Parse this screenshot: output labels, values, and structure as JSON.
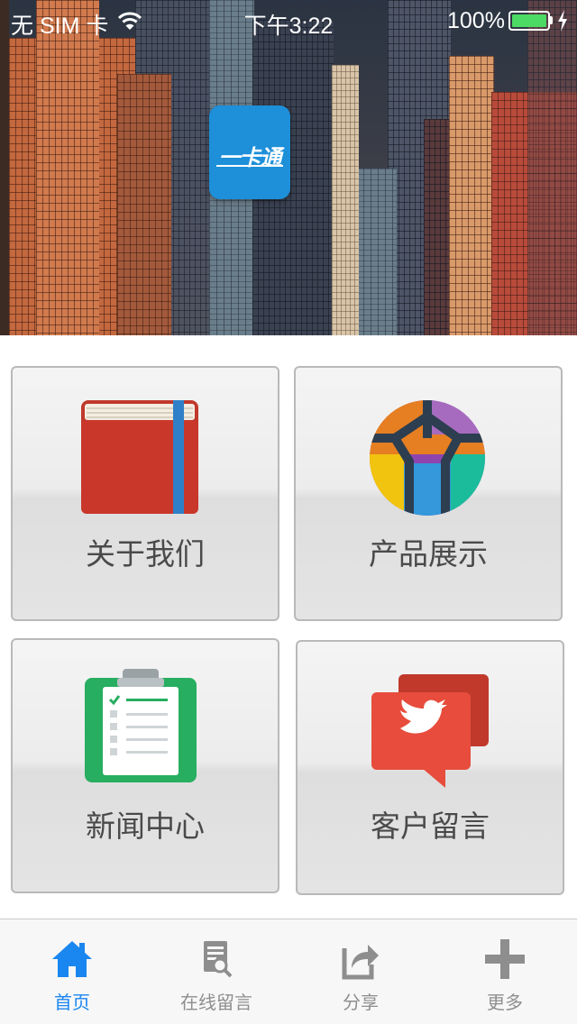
{
  "status_bar": {
    "carrier": "无 SIM 卡",
    "time": "下午3:22",
    "battery": "100%"
  },
  "logo": {
    "text": "一卡通"
  },
  "menu": {
    "items": [
      {
        "label": "关于我们",
        "icon": "red-book-icon"
      },
      {
        "label": "产品展示",
        "icon": "colorful-products-icon"
      },
      {
        "label": "新闻中心",
        "icon": "green-clipboard-icon"
      },
      {
        "label": "客户留言",
        "icon": "red-speech-bubble-bird-icon"
      }
    ]
  },
  "tab_bar": {
    "active_index": 0,
    "active_color": "#1a86f0",
    "inactive_color": "#8e8e8e",
    "tabs": [
      {
        "label": "首页",
        "icon": "home-icon"
      },
      {
        "label": "在线留言",
        "icon": "document-search-icon"
      },
      {
        "label": "分享",
        "icon": "share-icon"
      },
      {
        "label": "更多",
        "icon": "plus-icon"
      }
    ]
  },
  "colors": {
    "logo_blue": "#1e8fd9",
    "battery_green": "#4cd964"
  }
}
